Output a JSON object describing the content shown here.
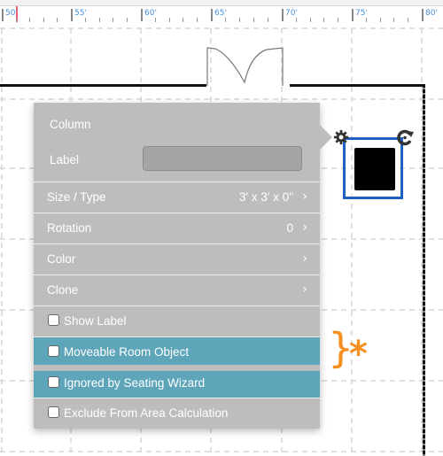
{
  "ruler": {
    "labels": [
      "50'",
      "55'",
      "60'",
      "65'",
      "70'",
      "75'",
      "80'"
    ]
  },
  "panel": {
    "title": "Column",
    "label_field": {
      "label": "Label",
      "value": "",
      "placeholder": ""
    },
    "rows": [
      {
        "label": "Size / Type",
        "value": "3' x 3' x 0\"",
        "chevron": "›"
      },
      {
        "label": "Rotation",
        "value": "0",
        "chevron": "›"
      },
      {
        "label": "Color",
        "value": "",
        "chevron": "›"
      },
      {
        "label": "Clone",
        "value": "",
        "chevron": "›"
      }
    ],
    "checkboxes": [
      {
        "label": "Show Label",
        "checked": false,
        "highlighted": false
      },
      {
        "label": "Moveable Room Object",
        "checked": false,
        "highlighted": true
      },
      {
        "label": "Ignored by Seating Wizard",
        "checked": false,
        "highlighted": true
      },
      {
        "label": "Exclude From Area Calculation",
        "checked": false,
        "highlighted": false
      }
    ]
  },
  "annotation": {
    "brace": "}",
    "mark": "*",
    "color": "#f59020"
  },
  "colors": {
    "panel_bg": "#bdbdbd",
    "highlight_row": "#5ea5b9",
    "selection": "#1e5fc2",
    "ruler_label": "#4a90d9"
  },
  "icons": {
    "gear": "gear-icon",
    "rotate": "rotate-icon",
    "chevron": "chevron-right-icon"
  }
}
